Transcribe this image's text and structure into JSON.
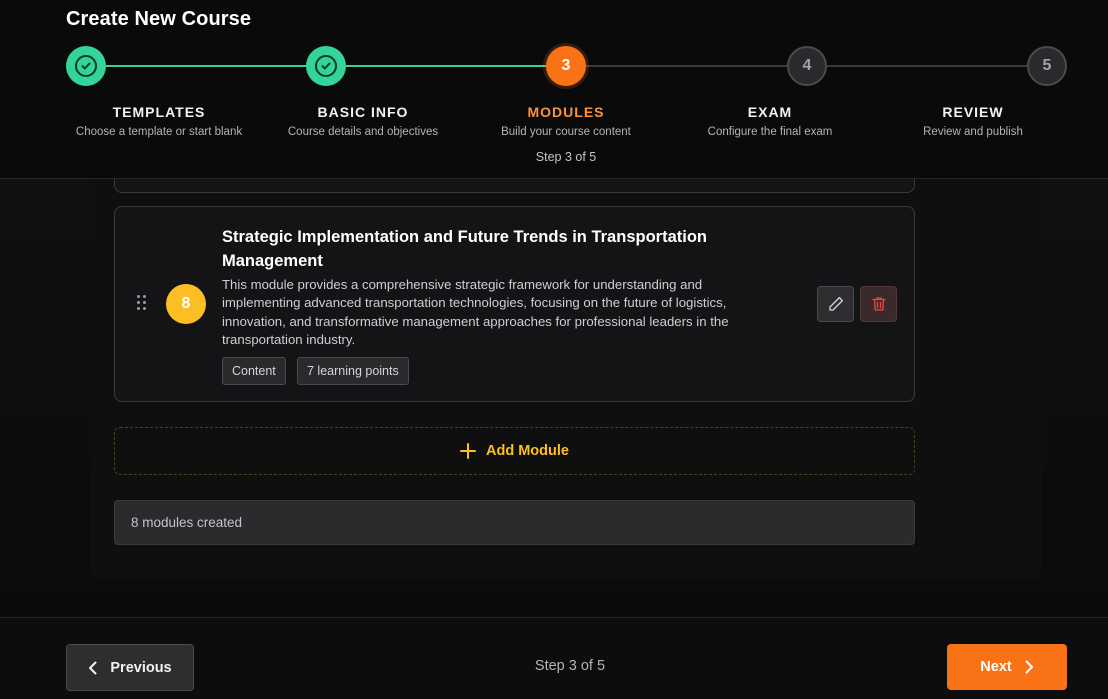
{
  "page_title": "Create New Course",
  "stepper": {
    "steps": [
      {
        "number": "1",
        "label": "TEMPLATES",
        "description": "Choose a template or start blank",
        "status": "complete"
      },
      {
        "number": "2",
        "label": "BASIC INFO",
        "description": "Course details and objectives",
        "status": "complete"
      },
      {
        "number": "3",
        "label": "MODULES",
        "description": "Build your course content",
        "status": "active"
      },
      {
        "number": "4",
        "label": "EXAM",
        "description": "Configure the final exam",
        "status": "pending"
      },
      {
        "number": "5",
        "label": "REVIEW",
        "description": "Review and publish",
        "status": "pending"
      }
    ],
    "active_step_caption": "Step 3 of 5"
  },
  "module": {
    "number": "8",
    "title": "Strategic Implementation and Future Trends in Transportation Management",
    "description": "This module provides a comprehensive strategic framework for understanding and implementing advanced transportation technologies, focusing on the future of logistics, innovation, and transformative management approaches for professional leaders in the transportation industry.",
    "tags": [
      "Content",
      "7 learning points"
    ],
    "icons": {
      "drag": "drag-handle-icon",
      "edit": "pencil-icon",
      "delete": "trash-icon"
    }
  },
  "add_module_label": "Add Module",
  "modules_count_text": "8 modules created",
  "footer": {
    "previous_label": "Previous",
    "step_text": "Step 3 of 5",
    "next_label": "Next"
  },
  "colors": {
    "complete": "#34d399",
    "active": "#f97316",
    "module_badge": "#fbbf24",
    "accent_yellow": "#fbbf24",
    "delete": "#ef4444"
  }
}
